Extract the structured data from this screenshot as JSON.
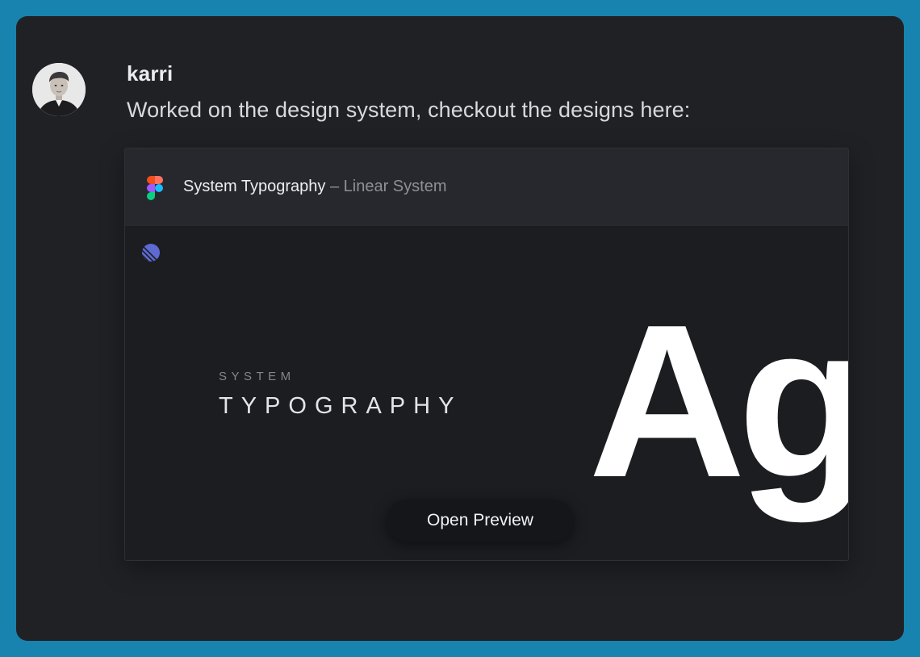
{
  "post": {
    "username": "karri",
    "message": "Worked on the design system, checkout the designs here:"
  },
  "card": {
    "icon": "figma-icon",
    "title": "System Typography",
    "separator": " – ",
    "project": "Linear System",
    "preview": {
      "logo": "linear-logo",
      "label_small": "SYSTEM",
      "label_large": "TYPOGRAPHY",
      "glyph": "Ag",
      "button_label": "Open Preview"
    }
  },
  "colors": {
    "background": "#1783ae",
    "window": "#202125",
    "card_header": "#27282d",
    "card_body": "#1c1d20",
    "linear_accent": "#5e6ad2"
  }
}
